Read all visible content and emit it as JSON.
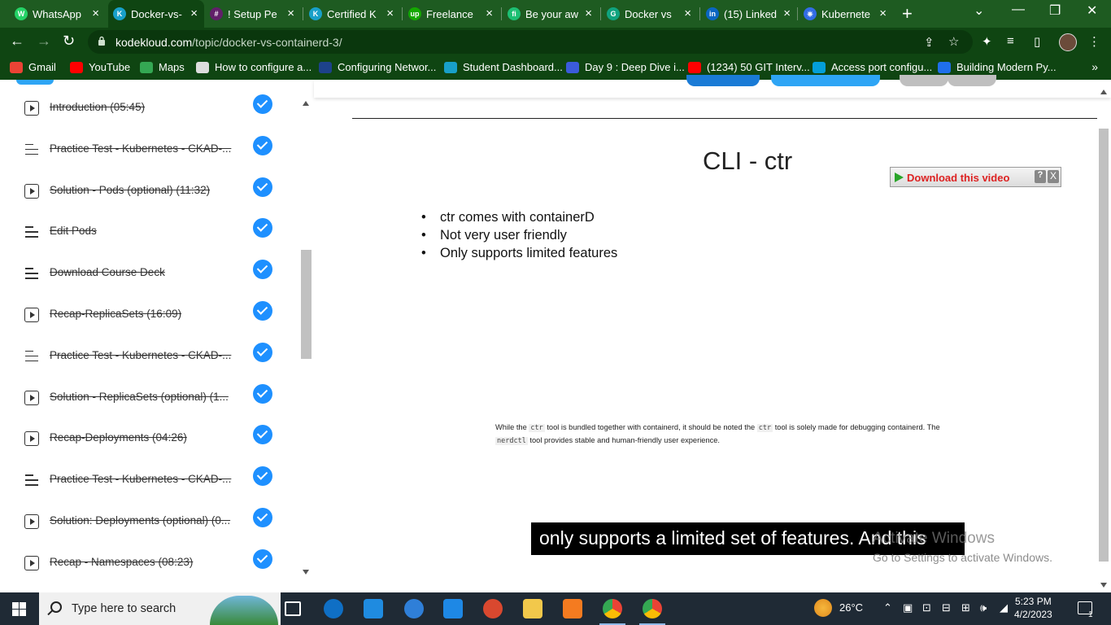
{
  "browser": {
    "tabs": [
      {
        "title": "WhatsApp",
        "fav_color": "#25d366",
        "fav_glyph": "W",
        "active": false
      },
      {
        "title": "Docker-vs-",
        "fav_color": "#18a0c9",
        "fav_glyph": "K",
        "active": true
      },
      {
        "title": "! Setup Pe",
        "fav_color": "#611f69",
        "fav_glyph": "#",
        "active": false
      },
      {
        "title": "Certified K",
        "fav_color": "#18a0c9",
        "fav_glyph": "K",
        "active": false
      },
      {
        "title": "Freelance",
        "fav_color": "#14a800",
        "fav_glyph": "up",
        "active": false
      },
      {
        "title": "Be your aw",
        "fav_color": "#1dbf73",
        "fav_glyph": "fi",
        "active": false
      },
      {
        "title": "Docker vs",
        "fav_color": "#10a37f",
        "fav_glyph": "G",
        "active": false
      },
      {
        "title": "(15) Linked",
        "fav_color": "#0a66c2",
        "fav_glyph": "in",
        "active": false
      },
      {
        "title": "Kubernete",
        "fav_color": "#326ce5",
        "fav_glyph": "⎈",
        "active": false
      }
    ],
    "url_host": "kodekloud.com",
    "url_path": "/topic/docker-vs-containerd-3/",
    "bookmarks": [
      {
        "label": "Gmail",
        "color": "#ea4335"
      },
      {
        "label": "YouTube",
        "color": "#ff0000"
      },
      {
        "label": "Maps",
        "color": "#34a853"
      },
      {
        "label": "How to configure a...",
        "color": "#dddddd"
      },
      {
        "label": "Configuring Networ...",
        "color": "#1d428a"
      },
      {
        "label": "Student Dashboard...",
        "color": "#18a0c9"
      },
      {
        "label": "Day 9 : Deep Dive i...",
        "color": "#3b5bdb"
      },
      {
        "label": "(1234) 50 GIT Interv...",
        "color": "#ff0000"
      },
      {
        "label": "Access port configu...",
        "color": "#049fd9"
      },
      {
        "label": "Building Modern Py...",
        "color": "#1f6feb"
      }
    ]
  },
  "sidebar": {
    "lessons": [
      {
        "title": "Introduction (05:45)",
        "icon": "play-icon"
      },
      {
        "title": "Practice Test - Kubernetes - CKAD-...",
        "icon": "doc-icon"
      },
      {
        "title": "Solution - Pods (optional) (11:32)",
        "icon": "play-icon"
      },
      {
        "title": "Edit Pods",
        "icon": "doc-icon"
      },
      {
        "title": "Download Course Deck",
        "icon": "doc-icon"
      },
      {
        "title": "Recap-ReplicaSets (16:09)",
        "icon": "play-icon"
      },
      {
        "title": "Practice Test - Kubernetes - CKAD-...",
        "icon": "doc-icon"
      },
      {
        "title": "Solution - ReplicaSets (optional) (1...",
        "icon": "play-icon"
      },
      {
        "title": "Recap-Deployments (04:26)",
        "icon": "play-icon"
      },
      {
        "title": "Practice Test - Kubernetes - CKAD-...",
        "icon": "doc-icon"
      },
      {
        "title": "Solution: Deployments (optional) (0...",
        "icon": "play-icon"
      },
      {
        "title": "Recap - Namespaces (08:23)",
        "icon": "play-icon"
      }
    ]
  },
  "slide": {
    "title": "CLI - ctr",
    "bullets": [
      "ctr comes with containerD",
      "Not very user friendly",
      "Only supports limited features"
    ],
    "note_prefix": "While the",
    "note_code1": "ctr",
    "note_mid1": "tool is bundled together with containerd, it should be noted the",
    "note_code2": "ctr",
    "note_mid2": "tool is solely made for debugging containerd. The",
    "note_code3": "nerdctl",
    "note_suffix": "tool provides stable and human-friendly user experience.",
    "caption": "only supports a limited set of features. And this"
  },
  "download_widget": {
    "label": "Download this video",
    "help": "?",
    "close": "X"
  },
  "watermark": {
    "line1": "Activate Windows",
    "line2": "Go to Settings to activate Windows."
  },
  "taskbar": {
    "search_placeholder": "Type here to search",
    "weather": "26°C",
    "time": "5:23 PM",
    "date": "4/2/2023",
    "notification_count": "1"
  }
}
